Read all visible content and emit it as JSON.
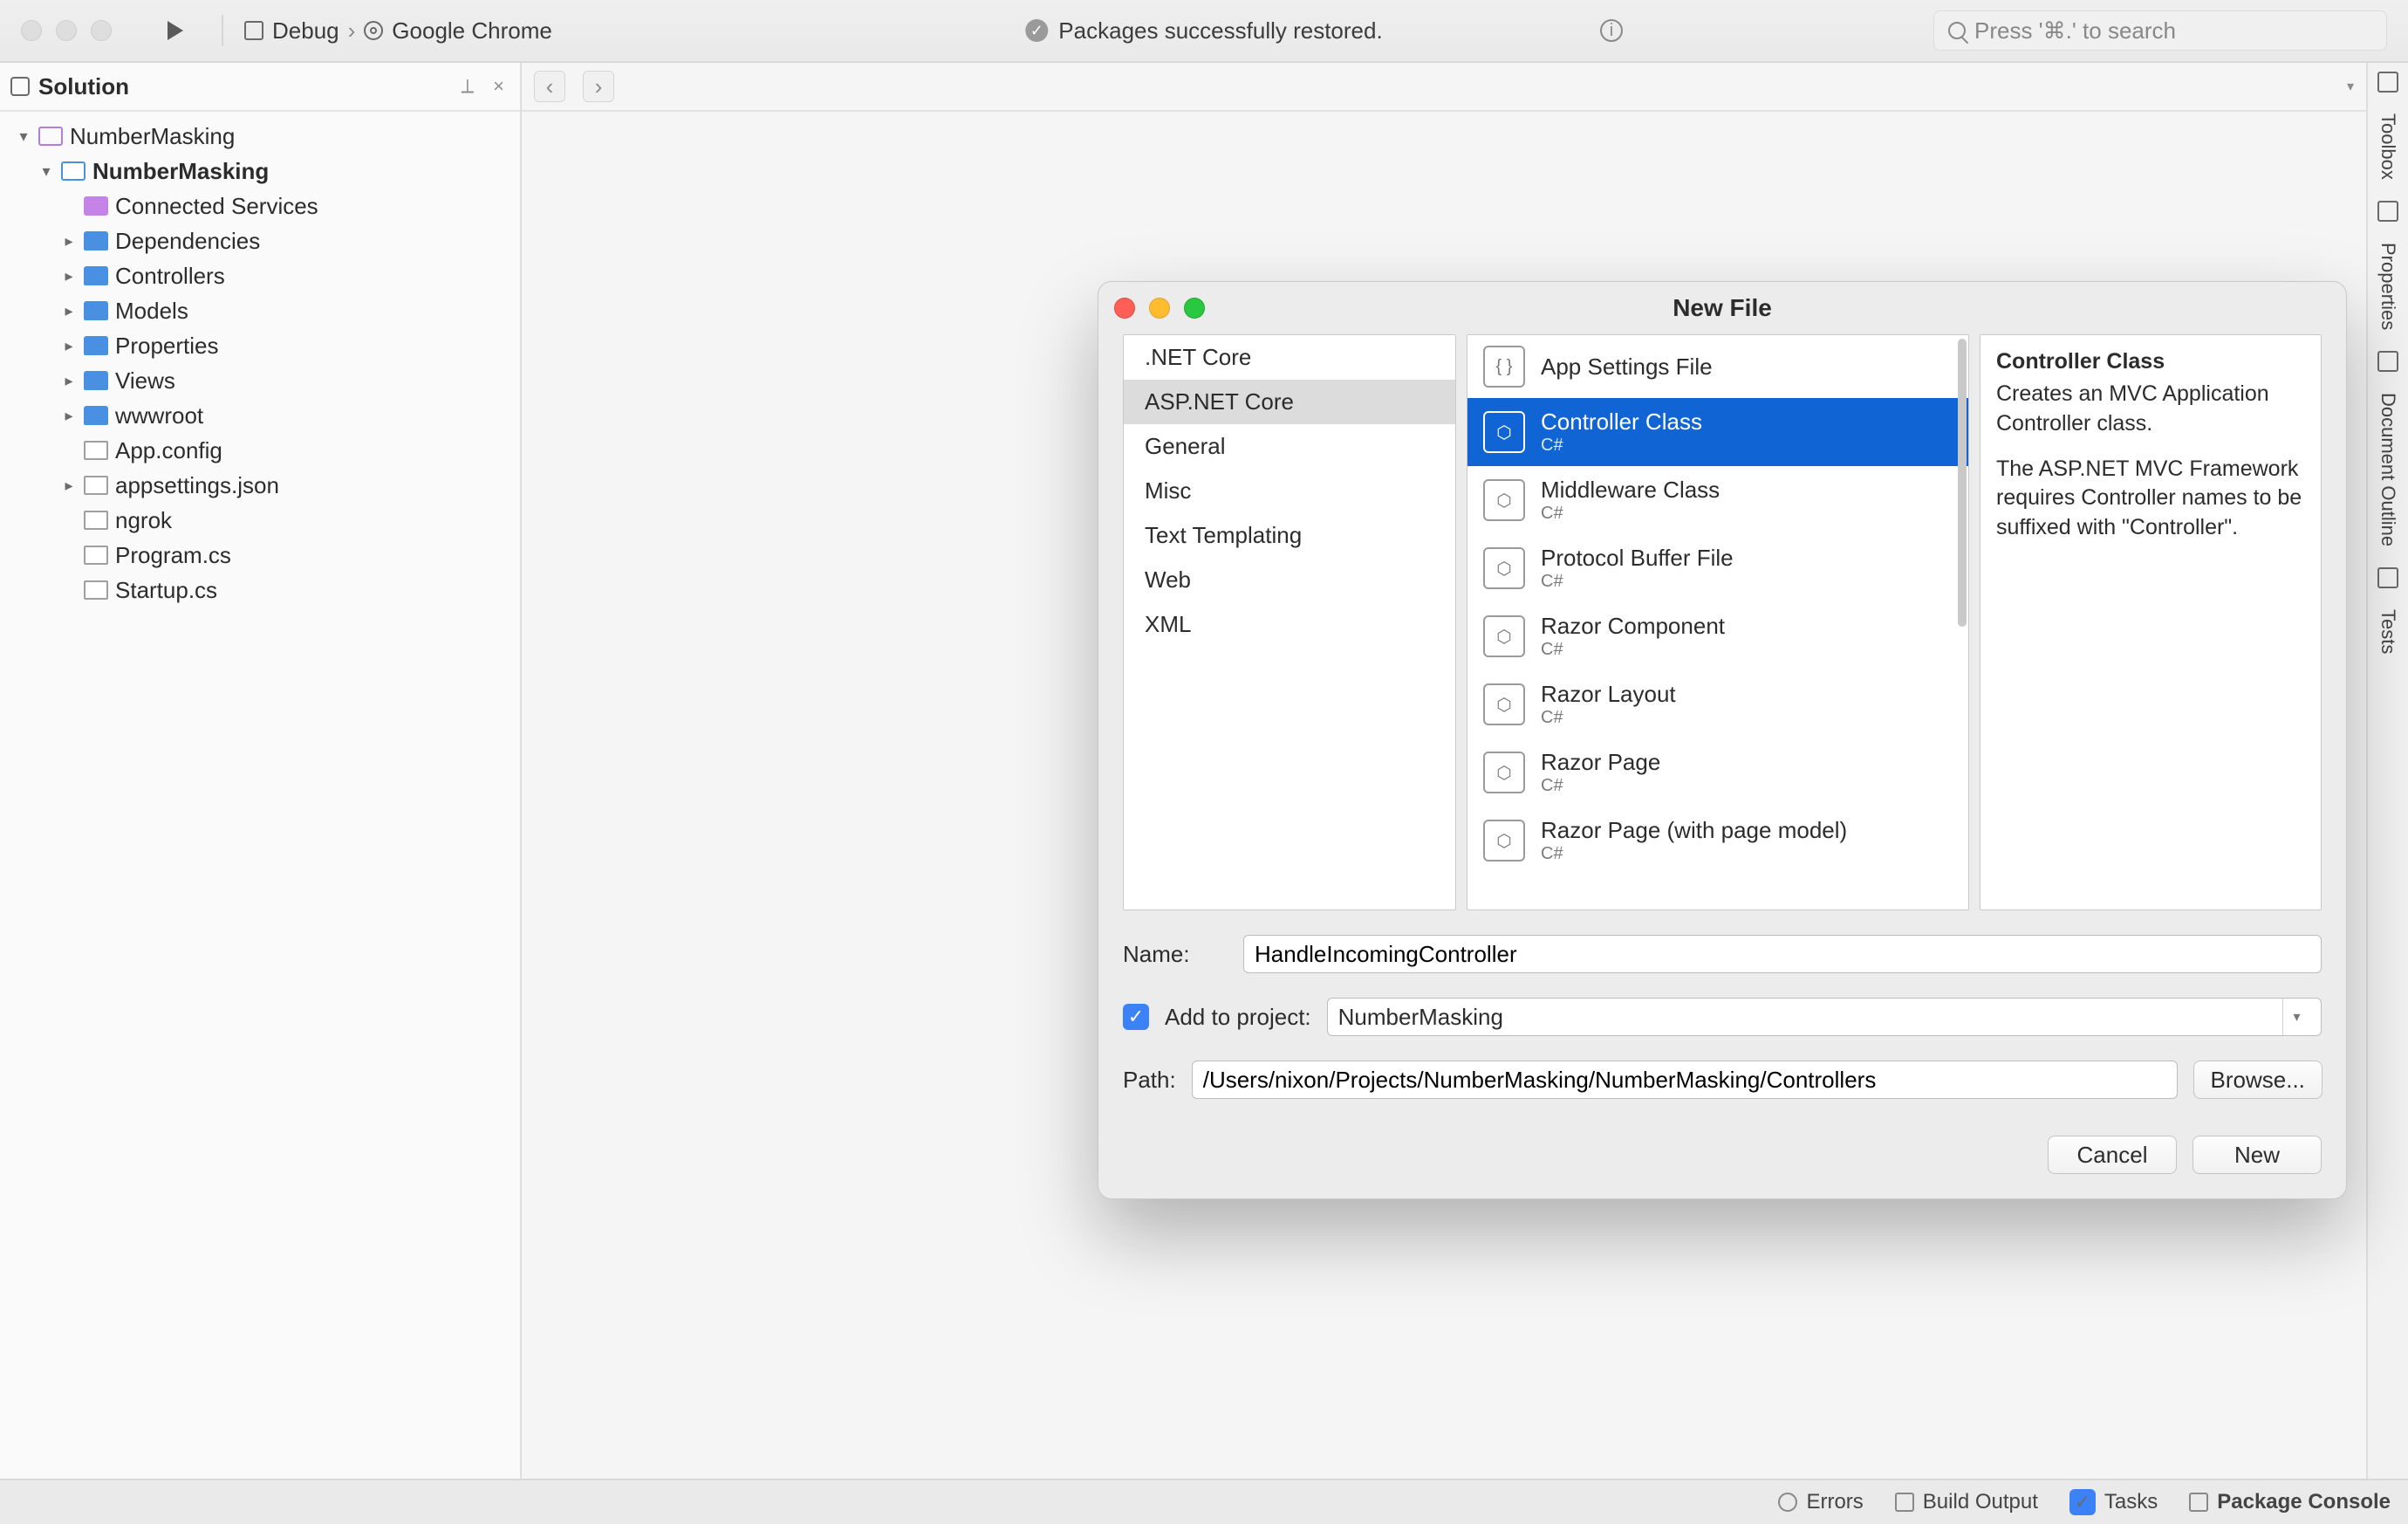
{
  "toolbar": {
    "config_debug": "Debug",
    "config_target": "Google Chrome",
    "status": "Packages successfully restored.",
    "search_placeholder": "Press '⌘.' to search"
  },
  "sidebar": {
    "title": "Solution",
    "solution_name": "NumberMasking",
    "project_name": "NumberMasking",
    "items": [
      {
        "label": "Connected Services",
        "icon": "svc"
      },
      {
        "label": "Dependencies",
        "icon": "fold",
        "expand": true
      },
      {
        "label": "Controllers",
        "icon": "fold",
        "expand": true
      },
      {
        "label": "Models",
        "icon": "fold",
        "expand": true
      },
      {
        "label": "Properties",
        "icon": "fold",
        "expand": true
      },
      {
        "label": "Views",
        "icon": "fold",
        "expand": true
      },
      {
        "label": "wwwroot",
        "icon": "fold",
        "expand": true
      },
      {
        "label": "App.config",
        "icon": "file"
      },
      {
        "label": "appsettings.json",
        "icon": "file",
        "expand": true
      },
      {
        "label": "ngrok",
        "icon": "file"
      },
      {
        "label": "Program.cs",
        "icon": "file"
      },
      {
        "label": "Startup.cs",
        "icon": "file"
      }
    ]
  },
  "rightrail": [
    "Toolbox",
    "Properties",
    "Document Outline",
    "Tests"
  ],
  "statusbar": {
    "errors": "Errors",
    "build": "Build Output",
    "tasks": "Tasks",
    "console": "Package Console"
  },
  "dialog": {
    "title": "New File",
    "categories": [
      ".NET Core",
      "ASP.NET Core",
      "General",
      "Misc",
      "Text Templating",
      "Web",
      "XML"
    ],
    "selected_category_index": 1,
    "templates": [
      {
        "name": "App Settings File",
        "lang": ""
      },
      {
        "name": "Controller Class",
        "lang": "C#"
      },
      {
        "name": "Middleware Class",
        "lang": "C#"
      },
      {
        "name": "Protocol Buffer File",
        "lang": "C#"
      },
      {
        "name": "Razor Component",
        "lang": "C#"
      },
      {
        "name": "Razor Layout",
        "lang": "C#"
      },
      {
        "name": "Razor Page",
        "lang": "C#"
      },
      {
        "name": "Razor Page (with page model)",
        "lang": "C#"
      }
    ],
    "selected_template_index": 1,
    "desc_title": "Controller Class",
    "desc_p1": "Creates an MVC Application Controller class.",
    "desc_p2": "The ASP.NET MVC Framework requires Controller names to be suffixed with \"Controller\".",
    "name_label": "Name:",
    "name_value": "HandleIncomingController",
    "add_label": "Add to project:",
    "project_value": "NumberMasking",
    "path_label": "Path:",
    "path_value": "/Users/nixon/Projects/NumberMasking/NumberMasking/Controllers",
    "browse": "Browse...",
    "cancel": "Cancel",
    "new": "New"
  }
}
